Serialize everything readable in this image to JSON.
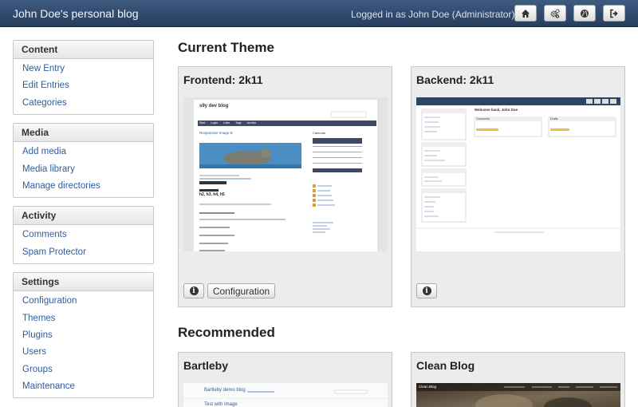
{
  "header": {
    "site_title": "John Doe's personal blog",
    "logged_in": "Logged in as John Doe (Administrator)",
    "buttons": [
      "home-icon",
      "cogs-icon",
      "globe-icon",
      "sign-out-icon"
    ]
  },
  "sidebar": {
    "groups": [
      {
        "title": "Content",
        "items": [
          "New Entry",
          "Edit Entries",
          "Categories"
        ]
      },
      {
        "title": "Media",
        "items": [
          "Add media",
          "Media library",
          "Manage directories"
        ]
      },
      {
        "title": "Activity",
        "items": [
          "Comments",
          "Spam Protector"
        ]
      },
      {
        "title": "Settings",
        "items": [
          "Configuration",
          "Themes",
          "Plugins",
          "Users",
          "Groups",
          "Maintenance"
        ]
      }
    ]
  },
  "main": {
    "current_theme_title": "Current Theme",
    "recommended_title": "Recommended",
    "frontend": {
      "title": "Frontend: 2k11",
      "config_label": "Configuration"
    },
    "backend": {
      "title": "Backend: 2k11"
    },
    "recommended": [
      {
        "title": "Bartleby"
      },
      {
        "title": "Clean Blog"
      }
    ],
    "preview_frontend": {
      "blog_title": "s9y dev blog",
      "nav": [
        "Start",
        "Login",
        "Links",
        "Tags",
        "Archive"
      ],
      "post_title": "Responsive Image D",
      "calendar_label": "Calendar",
      "sub_title": "h2, h3, h4, h5"
    },
    "preview_backend": {
      "welcome": "Welcome back, John Doe",
      "panel_left": "Comments",
      "panel_right": "Drafts"
    },
    "preview_bartleby": {
      "blog_title": "Bartleby demo blog",
      "post_title": "Test with Image"
    },
    "preview_clean": {
      "brand": "Clean Blog"
    }
  }
}
